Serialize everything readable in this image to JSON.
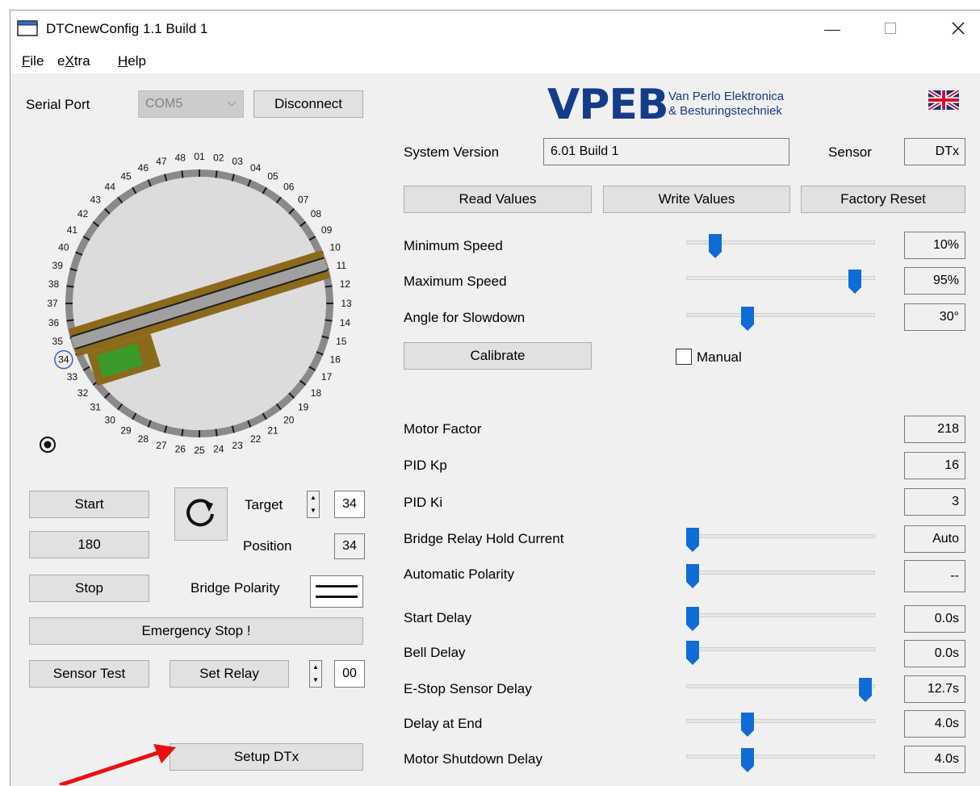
{
  "window": {
    "title": "DTCnewConfig 1.1 Build 1"
  },
  "menu": [
    {
      "label": "File",
      "underline": "F",
      "rest": "ile"
    },
    {
      "label": "eXtra",
      "pre": "e",
      "underline": "X",
      "rest": "tra"
    },
    {
      "label": "Help",
      "underline": "H",
      "rest": "elp"
    }
  ],
  "serial": {
    "label": "Serial Port",
    "port": "COM5",
    "disconnect": "Disconnect"
  },
  "logo": {
    "text": "VPEB",
    "line1": "Van Perlo Elektronica",
    "line2": "& Besturingstechniek"
  },
  "system": {
    "version_label": "System Version",
    "version_value": "6.01 Build 1",
    "sensor_label": "Sensor",
    "sensor_value": "DTx"
  },
  "actions": {
    "read": "Read Values",
    "write": "Write Values",
    "reset": "Factory Reset"
  },
  "sliders": {
    "min_speed": {
      "label": "Minimum Speed",
      "value": "10%",
      "level": 0.13
    },
    "max_speed": {
      "label": "Maximum Speed",
      "value": "95%",
      "level": 0.92
    },
    "slowdown": {
      "label": "Angle for Slowdown",
      "value": "30°",
      "level": 0.31
    }
  },
  "calibrate": {
    "label": "Calibrate",
    "manual": "Manual"
  },
  "params": {
    "motor_factor": {
      "label": "Motor Factor",
      "value": "218"
    },
    "pid_kp": {
      "label": "PID Kp",
      "value": "16"
    },
    "pid_ki": {
      "label": "PID Ki",
      "value": "3"
    },
    "bridge_relay": {
      "label": "Bridge Relay Hold Current",
      "value": "Auto",
      "level": 0.0
    },
    "auto_polarity": {
      "label": "Automatic Polarity",
      "value": "--",
      "level": 0.0
    },
    "start_delay": {
      "label": "Start Delay",
      "value": "0.0s",
      "level": 0.0
    },
    "bell_delay": {
      "label": "Bell Delay",
      "value": "0.0s",
      "level": 0.0
    },
    "estop_delay": {
      "label": "E-Stop Sensor Delay",
      "value": "12.7s",
      "level": 0.98
    },
    "end_delay": {
      "label": "Delay at End",
      "value": "4.0s",
      "level": 0.31
    },
    "shutdown_delay": {
      "label": "Motor Shutdown Delay",
      "value": "4.0s",
      "level": 0.31
    }
  },
  "turntable": {
    "tracks": [
      "01",
      "02",
      "03",
      "04",
      "05",
      "06",
      "07",
      "08",
      "09",
      "10",
      "11",
      "12",
      "13",
      "14",
      "15",
      "16",
      "17",
      "18",
      "19",
      "20",
      "21",
      "22",
      "23",
      "24",
      "25",
      "26",
      "27",
      "28",
      "29",
      "30",
      "31",
      "32",
      "33",
      "34",
      "35",
      "36",
      "37",
      "38",
      "39",
      "40",
      "41",
      "42",
      "43",
      "44",
      "45",
      "46",
      "47",
      "48"
    ],
    "selected": "34"
  },
  "controls": {
    "start": "Start",
    "angle": "180",
    "stop": "Stop",
    "target_label": "Target",
    "target_value": "34",
    "position_label": "Position",
    "position_value": "34",
    "polarity_label": "Bridge Polarity",
    "estop": "Emergency Stop !",
    "sensor_test": "Sensor Test",
    "set_relay": "Set Relay",
    "relay_value": "00",
    "setup": "Setup DTx"
  },
  "colors": {
    "slider_thumb": "#0f6cd6",
    "bridge": "#8b6a1c",
    "cabin": "#3a9b2a",
    "ring": "#808080",
    "selected_circle": "#3c5cd8",
    "arrow": "#e81010"
  }
}
